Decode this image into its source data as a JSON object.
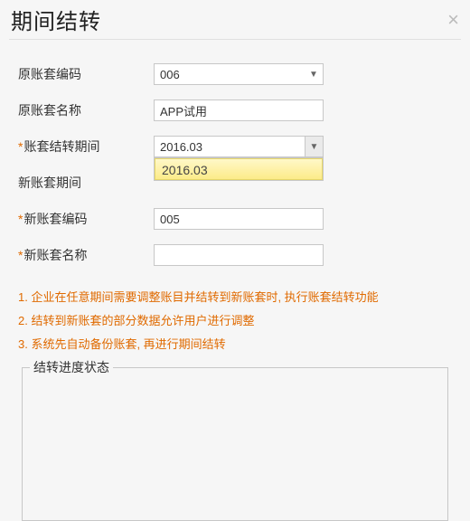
{
  "dialog": {
    "title": "期间结转",
    "close_label": "×"
  },
  "form": {
    "source_code": {
      "label": "原账套编码",
      "value": "006"
    },
    "source_name": {
      "label": "原账套名称",
      "value": "APP试用"
    },
    "period": {
      "label": "账套结转期间",
      "value": "2016.03",
      "required": true
    },
    "new_period": {
      "label": "新账套期间",
      "value": ""
    },
    "new_code": {
      "label": "新账套编码",
      "value": "005",
      "required": true
    },
    "new_name": {
      "label": "新账套名称",
      "value": "",
      "required": true
    }
  },
  "dropdown": {
    "options": [
      "2016.03"
    ]
  },
  "notes": {
    "n1": "1. 企业在任意期间需要调整账目并结转到新账套时, 执行账套结转功能",
    "n2": "2. 结转到新账套的部分数据允许用户进行调整",
    "n3": "3. 系统先自动备份账套, 再进行期间结转"
  },
  "status": {
    "legend": "结转进度状态"
  },
  "req_mark": "*"
}
